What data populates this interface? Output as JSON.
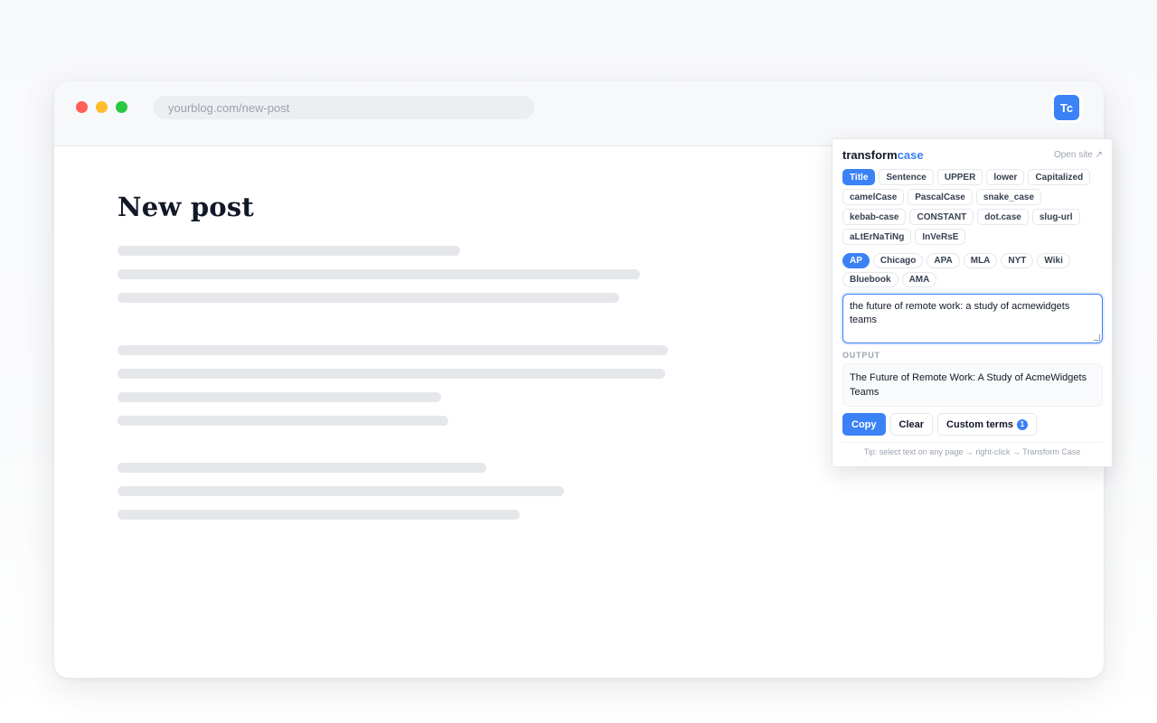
{
  "browser": {
    "url": "yourblog.com/new-post",
    "extension_icon_label": "Tc"
  },
  "page": {
    "title": "New post"
  },
  "popup": {
    "brand_main": "transform",
    "brand_accent": "case",
    "open_site_label": "Open site ↗",
    "case_options": [
      "Title",
      "Sentence",
      "UPPER",
      "lower",
      "Capitalized",
      "camelCase",
      "PascalCase",
      "snake_case",
      "kebab-case",
      "CONSTANT",
      "dot.case",
      "slug-url",
      "aLtErNaTiNg",
      "InVeRsE"
    ],
    "active_case": "Title",
    "style_options": [
      "AP",
      "Chicago",
      "APA",
      "MLA",
      "NYT",
      "Wiki",
      "Bluebook",
      "AMA"
    ],
    "active_style": "AP",
    "input_text": "the future of remote work: a study of acmewidgets teams",
    "output_label": "OUTPUT",
    "output_text": "The Future of Remote Work: A Study of AcmeWidgets Teams",
    "copy_label": "Copy",
    "clear_label": "Clear",
    "custom_terms_label": "Custom terms",
    "custom_terms_count": "1",
    "tip": "Tip: select text on any page → right-click → Transform Case"
  },
  "colors": {
    "accent": "#3b82f6",
    "mac_red": "#ff5f57",
    "mac_yellow": "#febc2e",
    "mac_green": "#28c840"
  }
}
